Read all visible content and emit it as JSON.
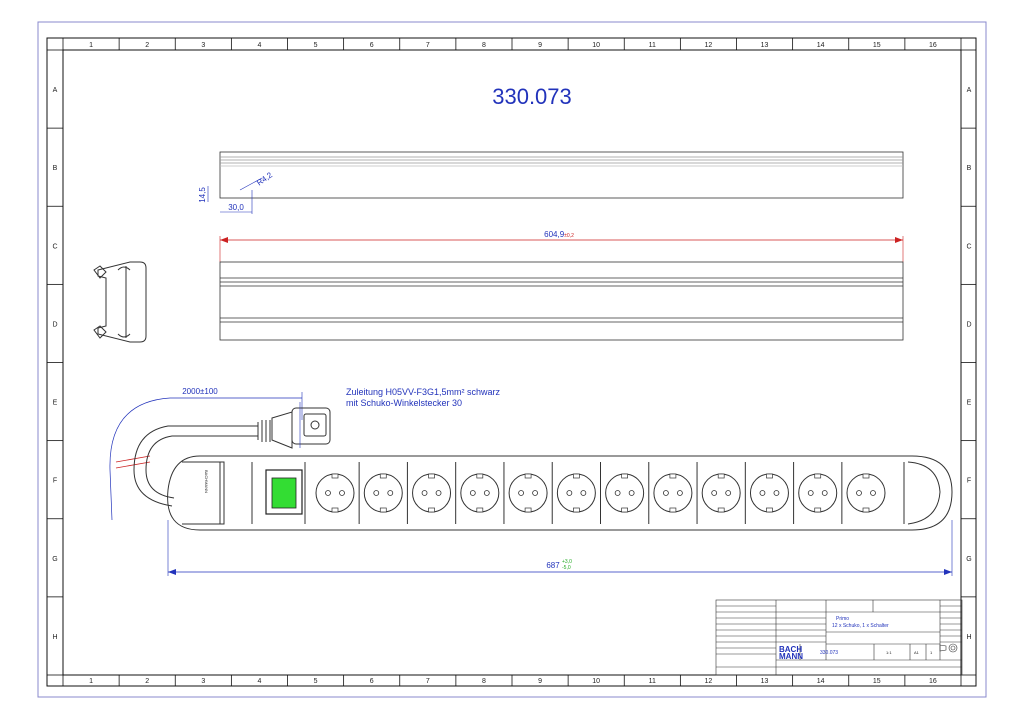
{
  "drawing": {
    "part_number": "330.073",
    "columns": [
      "1",
      "2",
      "3",
      "4",
      "5",
      "6",
      "7",
      "8",
      "9",
      "10",
      "11",
      "12",
      "13",
      "14",
      "15",
      "16"
    ],
    "rows": [
      "A",
      "B",
      "C",
      "D",
      "E",
      "F",
      "G",
      "H"
    ]
  },
  "profile_view": {
    "dim_height": "14,5",
    "dim_width": "30,0",
    "dim_radius": "R4,2"
  },
  "top_view": {
    "dim_length": "604,9",
    "dim_length_tol": "±0,2"
  },
  "cable": {
    "dim_length": "2000±100",
    "note_line1": "Zuleitung H05VV-F3G1,5mm² schwarz",
    "note_line2": "mit Schuko-Winkelstecker 30"
  },
  "strip": {
    "brand_label": "BACHMANN",
    "socket_count": 12,
    "dim_length": "687",
    "dim_tol_upper": "+3,0",
    "dim_tol_lower": "-5,0",
    "switch_color": "#33dd33"
  },
  "title_block": {
    "title_en": "Primo",
    "description": "12 x Schuko, 1 x Schalter",
    "number": "330.073",
    "logo_line1": "BACH",
    "logo_line2": "MANN",
    "scale": "1:1",
    "format": "A1",
    "sheet": "1"
  }
}
